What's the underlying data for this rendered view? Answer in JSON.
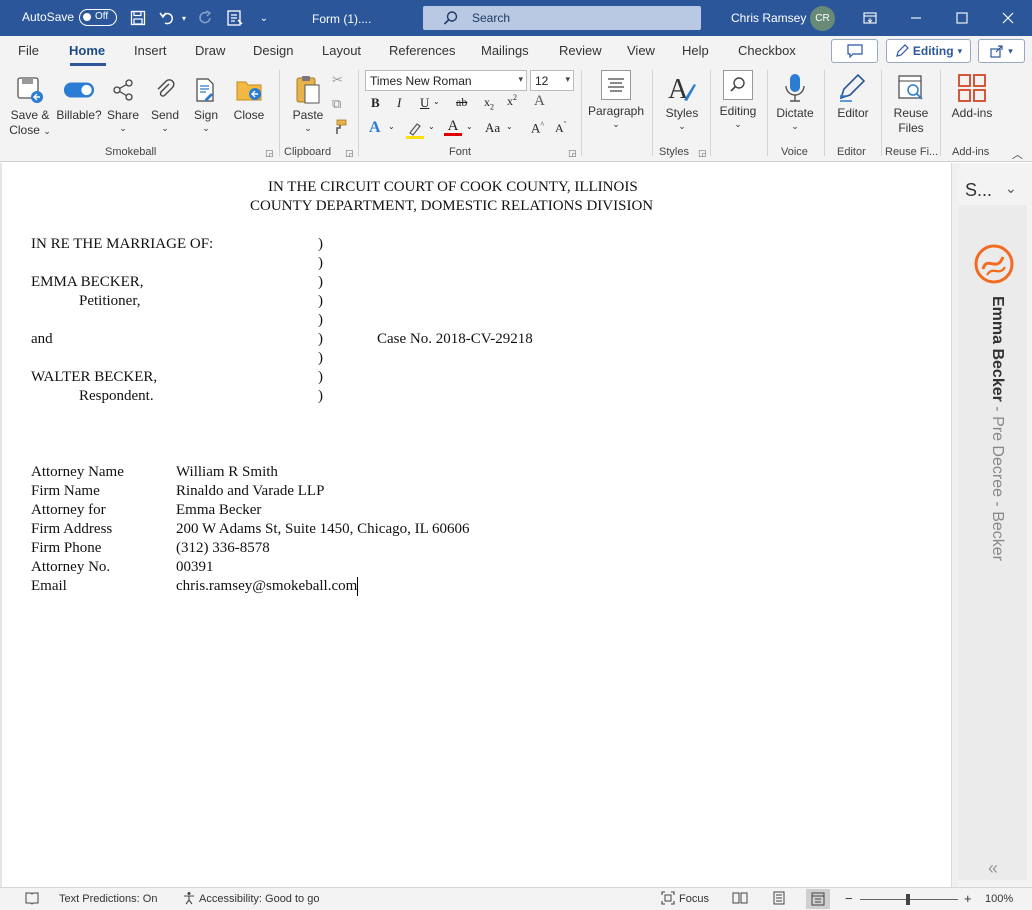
{
  "titlebar": {
    "autosave_label": "AutoSave",
    "autosave_state": "Off",
    "doc_title": "Form (1)....",
    "search_placeholder": "Search",
    "user_name": "Chris Ramsey",
    "user_initials": "CR"
  },
  "tabs": [
    "File",
    "Home",
    "Insert",
    "Draw",
    "Design",
    "Layout",
    "References",
    "Mailings",
    "Review",
    "View",
    "Help",
    "Checkbox"
  ],
  "active_tab": "Home",
  "editing_mode": "Editing",
  "ribbon": {
    "smokeball": {
      "save_close": "Save &",
      "save_close_2": "Close",
      "billable": "Billable?",
      "share": "Share",
      "send": "Send",
      "sign": "Sign",
      "close": "Close",
      "group": "Smokeball"
    },
    "clipboard": {
      "paste": "Paste",
      "group": "Clipboard"
    },
    "font": {
      "name": "Times New Roman",
      "size": "12",
      "group": "Font"
    },
    "paragraph": {
      "label": "Paragraph"
    },
    "styles": {
      "label": "Styles",
      "group": "Styles"
    },
    "editing": {
      "label": "Editing"
    },
    "voice": {
      "dictate": "Dictate",
      "group": "Voice"
    },
    "editor": {
      "label": "Editor",
      "group": "Editor"
    },
    "reuse": {
      "label": "Reuse",
      "label_2": "Files",
      "group": "Reuse Fi..."
    },
    "addins": {
      "label": "Add-ins",
      "group": "Add-ins"
    }
  },
  "document": {
    "heading1": "IN THE CIRCUIT COURT OF COOK COUNTY, ILLINOIS",
    "heading2": "COUNTY DEPARTMENT, DOMESTIC RELATIONS DIVISION",
    "caption": {
      "in_re": "IN RE THE MARRIAGE OF:",
      "petitioner_name": "EMMA BECKER,",
      "petitioner_role": "Petitioner,",
      "and": "and",
      "respondent_name": "WALTER BECKER,",
      "respondent_role": "Respondent.",
      "paren": ")",
      "case_no": "Case No. 2018-CV-29218"
    },
    "attorney": [
      {
        "label": "Attorney Name",
        "value": "William R Smith"
      },
      {
        "label": "Firm Name",
        "value": "Rinaldo and Varade LLP"
      },
      {
        "label": "Attorney for",
        "value": "Emma Becker"
      },
      {
        "label": "Firm Address",
        "value": "200 W Adams St, Suite 1450, Chicago, IL 60606"
      },
      {
        "label": "Firm Phone",
        "value": "(312) 336-8578"
      },
      {
        "label": "Attorney No.",
        "value": "00391"
      },
      {
        "label": "Email",
        "value": "chris.ramsey@smokeball.com"
      }
    ]
  },
  "sidepane": {
    "title": "S...",
    "vertical_name": "Emma Becker",
    "vertical_rest": " - Pre Decree - Becker"
  },
  "statusbar": {
    "text_predictions": "Text Predictions: On",
    "accessibility": "Accessibility: Good to go",
    "focus": "Focus",
    "zoom": "100%",
    "minus": "−",
    "plus": "+"
  },
  "colors": {
    "titlebar": "#2b579a",
    "accent": "#2b579a",
    "smokeball_orange": "#f26b21"
  }
}
